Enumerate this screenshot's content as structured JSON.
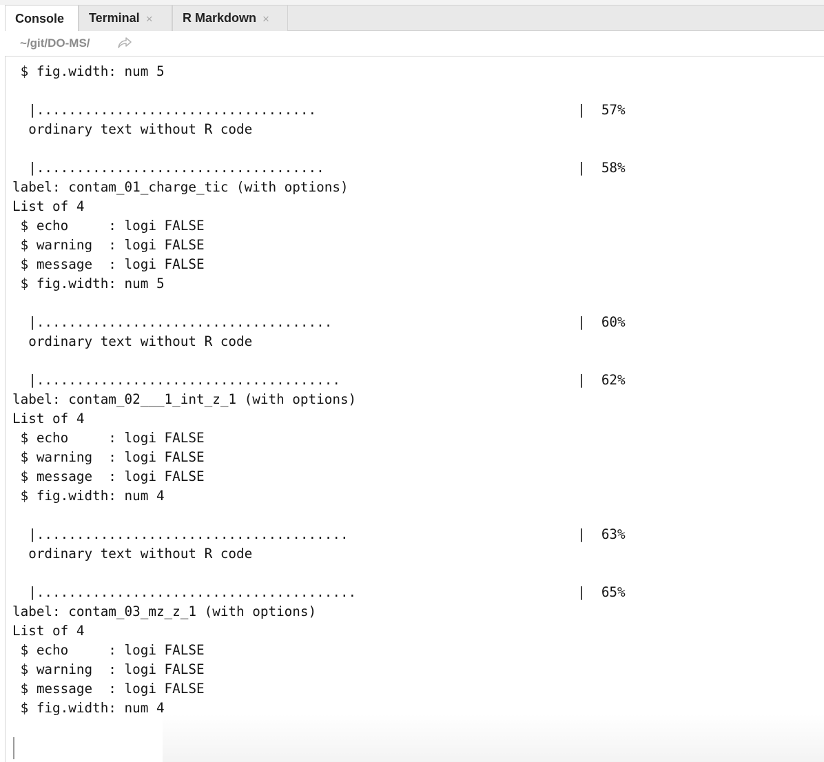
{
  "tabs": [
    {
      "label": "Console",
      "active": true,
      "closable": false
    },
    {
      "label": "Terminal",
      "active": false,
      "closable": true
    },
    {
      "label": "R Markdown",
      "active": false,
      "closable": true
    }
  ],
  "close_glyph": "×",
  "path": {
    "text": "~/git/DO-MS/",
    "icon": "go-to-directory-icon"
  },
  "console_lines": [
    " $ fig.width: num 5",
    "",
    "  |...................................",
    "  ordinary text without R code",
    "",
    "  |....................................",
    "label: contam_01_charge_tic (with options)",
    "List of 4",
    " $ echo     : logi FALSE",
    " $ warning  : logi FALSE",
    " $ message  : logi FALSE",
    " $ fig.width: num 5",
    "",
    "  |.....................................",
    "  ordinary text without R code",
    "",
    "  |......................................",
    "label: contam_02___1_int_z_1 (with options)",
    "List of 4",
    " $ echo     : logi FALSE",
    " $ warning  : logi FALSE",
    " $ message  : logi FALSE",
    " $ fig.width: num 4",
    "",
    "  |.......................................",
    "  ordinary text without R code",
    "",
    "  |........................................",
    "label: contam_03_mz_z_1 (with options)",
    "List of 4",
    " $ echo     : logi FALSE",
    " $ warning  : logi FALSE",
    " $ message  : logi FALSE",
    " $ fig.width: num 4"
  ],
  "progress_markers": [
    {
      "line": 2,
      "text": "|  57%"
    },
    {
      "line": 5,
      "text": "|  58%"
    },
    {
      "line": 13,
      "text": "|  60%"
    },
    {
      "line": 16,
      "text": "|  62%"
    },
    {
      "line": 24,
      "text": "|  63%"
    },
    {
      "line": 27,
      "text": "|  65%"
    }
  ],
  "colors": {
    "tab_bar": "#e9e9e9",
    "path_text": "#8b8b8b",
    "console_text": "#151515"
  }
}
